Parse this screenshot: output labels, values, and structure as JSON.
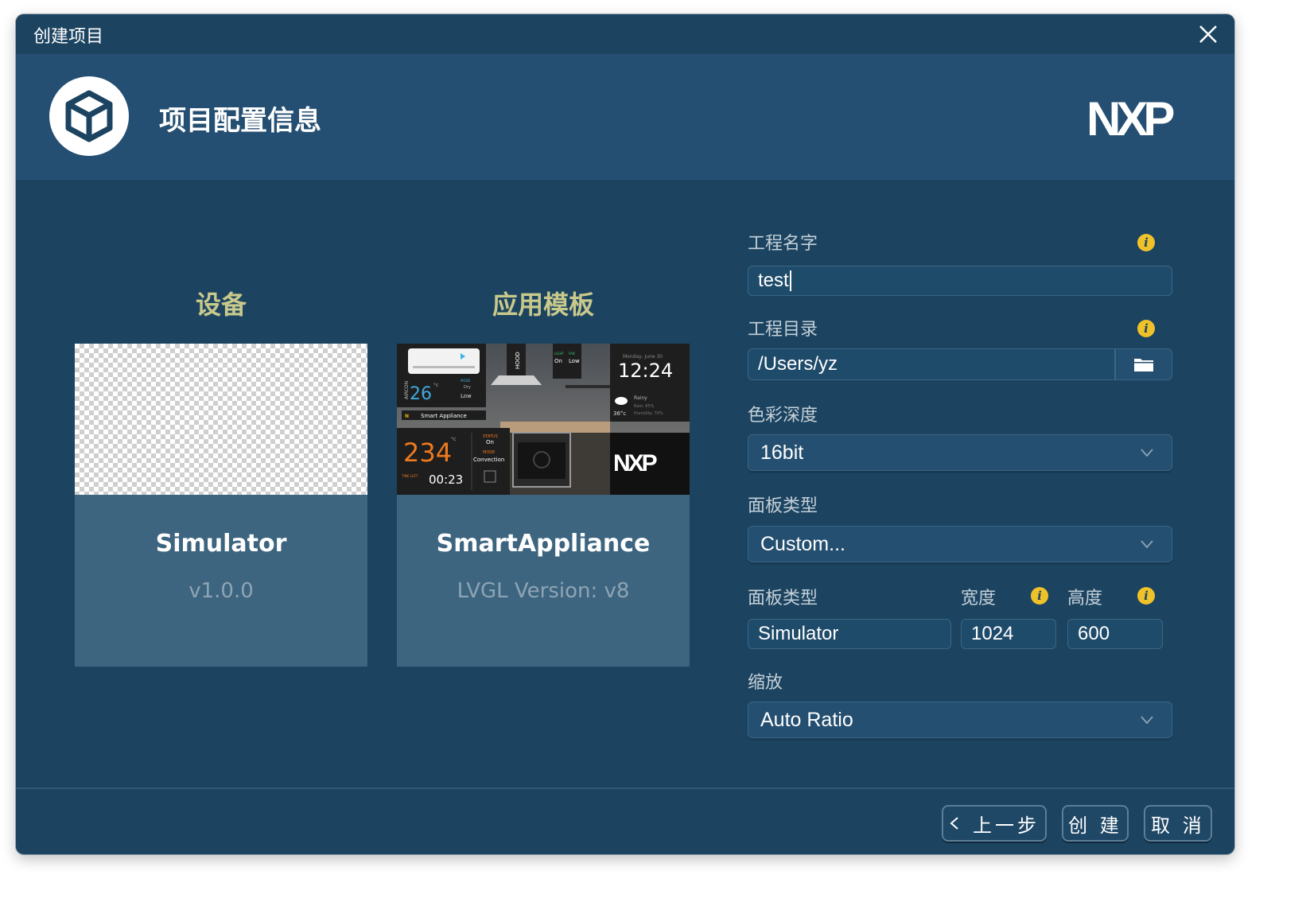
{
  "window": {
    "title": "创建项目"
  },
  "header": {
    "title": "项目配置信息",
    "brand_logo": "NXP",
    "colors": {
      "header_bg": "#254f72",
      "window_bg": "#1c4461",
      "accent_label": "#c9c98c",
      "info_icon": "#f0c22a"
    }
  },
  "columns": {
    "device": {
      "heading": "设备",
      "card": {
        "name": "Simulator",
        "version": "v1.0.0",
        "thumbnail": "transparent-checkerboard"
      }
    },
    "template": {
      "heading": "应用模板",
      "card": {
        "name": "SmartAppliance",
        "version": "LVGL Version: v8",
        "thumbnail": {
          "aircon_label": "AIRCON",
          "aircon_temp": "26",
          "aircon_unit": "°c",
          "mode_label": "MODE",
          "mode_value": "Dry",
          "fan_value": "Low",
          "hood_label": "HOOD",
          "light_label": "LIGHT",
          "fan_label": "FAN",
          "light_value": "On",
          "hood_fan_value": "Low",
          "date": "Monday, June 30",
          "clock": "12:24",
          "weather": "Rainy",
          "rain": "Rain: 85%",
          "humidity": "Humidity: 70%",
          "outdoor_temp": "36°c",
          "brand_strip": "Smart Appliance",
          "oven_temp": "234",
          "oven_unit": "°c",
          "status_label": "STATUS",
          "status_value": "On",
          "oven_mode_label": "MODE",
          "oven_mode_value": "Convection",
          "time_left_label": "TIME LEFT",
          "time_left": "00:23",
          "logo": "NXP"
        }
      }
    }
  },
  "form": {
    "project_name": {
      "label": "工程名字",
      "value": "test"
    },
    "project_dir": {
      "label": "工程目录",
      "value": "/Users/yz"
    },
    "color_depth": {
      "label": "色彩深度",
      "value": "16bit"
    },
    "panel_type": {
      "label": "面板类型",
      "value": "Custom..."
    },
    "panel_row": {
      "label": "面板类型",
      "value": "Simulator",
      "width_label": "宽度",
      "width_value": "1024",
      "height_label": "高度",
      "height_value": "600"
    },
    "scale": {
      "label": "缩放",
      "value": "Auto Ratio"
    }
  },
  "footer": {
    "prev_label": "上一步",
    "create_label": "创 建",
    "cancel_label": "取 消"
  }
}
